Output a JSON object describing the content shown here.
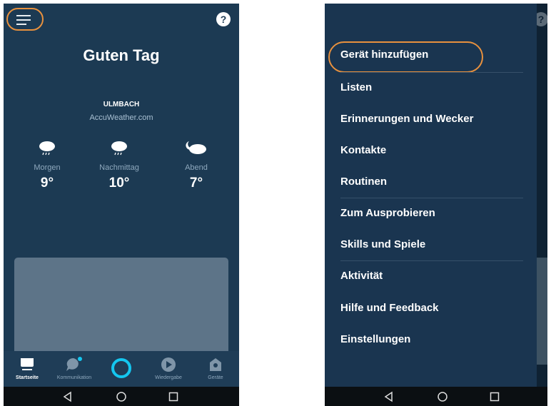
{
  "colors": {
    "background": "#1c3a53",
    "highlight": "#e8913e",
    "accent": "#14c7f0",
    "muted": "#8ea8bd"
  },
  "home": {
    "menu_icon": "hamburger-menu-icon",
    "help_icon": "help-icon",
    "help_symbol": "?",
    "greeting": "Guten Tag",
    "weather": {
      "location": "ULMBACH",
      "source": "AccuWeather.com",
      "forecast": [
        {
          "period": "Morgen",
          "temp": "9°",
          "icon": "rain-cloud-icon"
        },
        {
          "period": "Nachmittag",
          "temp": "10°",
          "icon": "rain-cloud-icon"
        },
        {
          "period": "Abend",
          "temp": "7°",
          "icon": "moon-cloud-icon"
        }
      ]
    },
    "tabs": [
      {
        "label": "Startseite",
        "icon": "home-icon",
        "active": true
      },
      {
        "label": "Kommunikation",
        "icon": "chat-bubble-icon",
        "active": false
      },
      {
        "label": "",
        "icon": "alexa-ring-icon",
        "active": false
      },
      {
        "label": "Wiedergabe",
        "icon": "play-icon",
        "active": false
      },
      {
        "label": "Geräte",
        "icon": "devices-icon",
        "active": false
      }
    ]
  },
  "drawer": {
    "items": [
      {
        "label": "Gerät hinzufügen"
      },
      {
        "label": "Listen"
      },
      {
        "label": "Erinnerungen und Wecker"
      },
      {
        "label": "Kontakte"
      },
      {
        "label": "Routinen"
      },
      {
        "label": "Zum Ausprobieren"
      },
      {
        "label": "Skills und Spiele"
      },
      {
        "label": "Aktivität"
      },
      {
        "label": "Hilfe und Feedback"
      },
      {
        "label": "Einstellungen"
      }
    ]
  },
  "system_nav": [
    "back-icon",
    "home-circle-icon",
    "recents-icon"
  ]
}
